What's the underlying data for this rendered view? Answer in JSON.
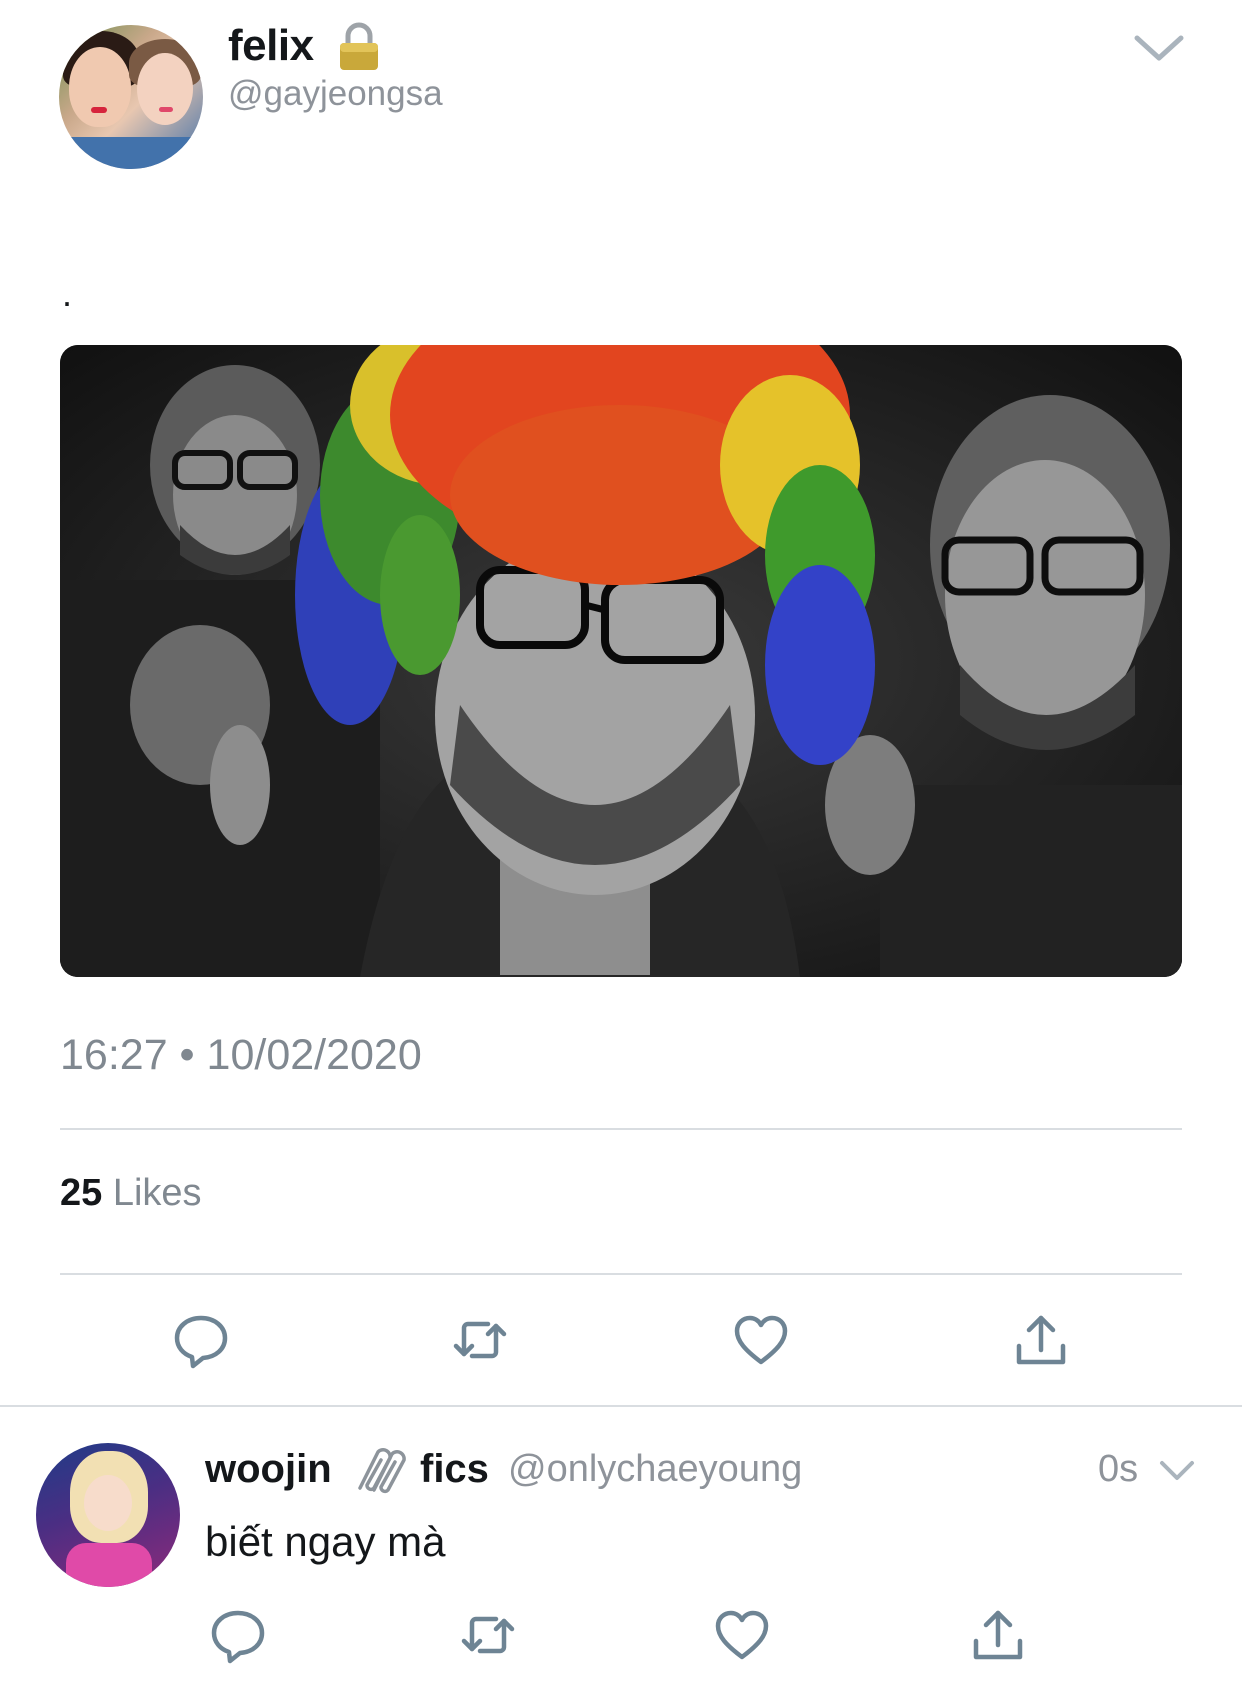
{
  "tweet": {
    "name": "felix",
    "handle": "@gayjeongsa",
    "text": ".",
    "timestamp": "16:27 • 10/02/2020",
    "likes_count": "25",
    "likes_label": "Likes",
    "lock_icon": "lock-icon",
    "actions": [
      "reply-icon",
      "retweet-icon",
      "like-icon",
      "share-icon"
    ]
  },
  "reply": {
    "name": "woojin",
    "name_icon": "paperclip-icon",
    "name_suffix": "fics",
    "handle": "@onlychaeyoung",
    "time": "0s",
    "text": "biết ngay mà",
    "actions": [
      "reply-icon",
      "retweet-icon",
      "like-icon",
      "share-icon"
    ]
  },
  "colors": {
    "text": "#14171a",
    "secondary": "#808890",
    "divider": "#d9dde1",
    "icon": "#6e8494"
  }
}
